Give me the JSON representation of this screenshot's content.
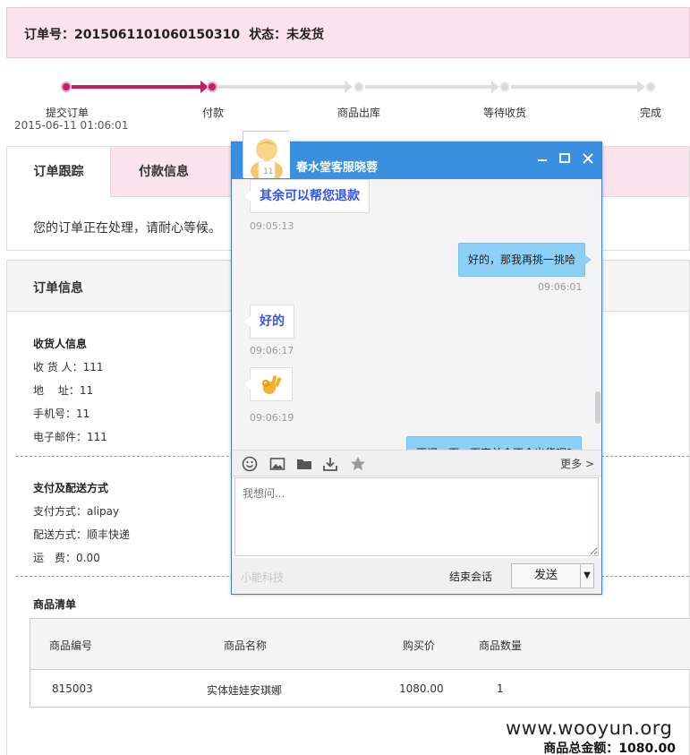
{
  "order": {
    "number_label": "订单号：",
    "number": "2015061101060150310",
    "status_label": "状态：",
    "status": "未发货"
  },
  "progress": {
    "steps": [
      "提交订单",
      "付款",
      "商品出库",
      "等待收货",
      "完成"
    ],
    "submit_time": "2015-06-11 01:06:01",
    "completed_steps": 2
  },
  "tabs": {
    "items": [
      "订单跟踪",
      "付款信息"
    ],
    "active": "订单跟踪",
    "message": "您的订单正在处理，请耐心等候。"
  },
  "order_info": {
    "title": "订单信息",
    "receiver": {
      "title": "收货人信息",
      "name": "收 货 人：111",
      "address": "地　 址：11",
      "phone": "手机号：11",
      "email": "电子邮件：111"
    },
    "payment": {
      "title": "支付及配送方式",
      "method": "支付方式：alipay",
      "shipping": "配送方式：顺丰快递",
      "fee": "运　费：0.00"
    },
    "goods": {
      "title": "商品清单",
      "columns": [
        "商品编号",
        "商品名称",
        "购买价",
        "商品数量"
      ],
      "rows": [
        [
          "815003",
          "实体娃娃安琪娜",
          "1080.00",
          "1"
        ]
      ],
      "total": "商品总金额：1080.00"
    }
  },
  "watermark": "www.wooyun.org",
  "chat": {
    "title": "春水堂客服晓蓉",
    "messages": [
      {
        "dir": "in",
        "text": "其余可以帮您退款",
        "time": "09:05:13"
      },
      {
        "dir": "out",
        "text": "好的，那我再挑一挑哈",
        "time": "09:06:01"
      },
      {
        "dir": "in",
        "text": "好的",
        "time": "09:06:17"
      },
      {
        "dir": "in",
        "text": "",
        "time": "09:06:19",
        "emoji": "ok-hand-emoji"
      },
      {
        "dir": "out",
        "text": "再问一下，下家单会不会出货呢?",
        "time": ""
      }
    ],
    "toolbar_more": "更多 >",
    "input_placeholder": "我想问...",
    "brand": "小能科技",
    "end_label": "结束会话",
    "send_label": "发送",
    "send_drop": "▼"
  },
  "colors": {
    "accent": "#c21d68",
    "header_bg": "#fbe3ee",
    "chat_blue": "#3b8fe0",
    "bubble_out": "#8dd0f7",
    "bubble_in_text": "#3355ee"
  }
}
